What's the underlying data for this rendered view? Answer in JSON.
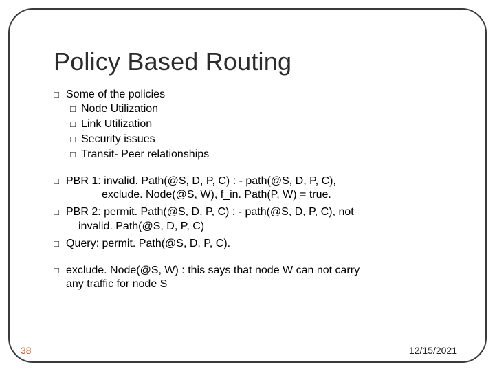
{
  "title": "Policy Based Routing",
  "section1": {
    "heading": "Some of the policies",
    "items": [
      "Node Utilization",
      "Link Utilization",
      "Security issues",
      "Transit- Peer relationships"
    ]
  },
  "section2": {
    "pbr1_line1": "PBR 1: invalid. Path(@S, D, P, C) : - path(@S, D, P, C),",
    "pbr1_line2": "exclude. Node(@S, W), f_in. Path(P, W) = true.",
    "pbr2_line1": "PBR 2: permit. Path(@S, D, P, C) : - path(@S, D, P, C), not",
    "pbr2_line2": "invalid. Path(@S, D, P, C)",
    "query": "Query: permit. Path(@S, D, P, C)."
  },
  "section3": {
    "line1": "exclude. Node(@S, W) : this says that node W can not carry",
    "line2": "any traffic for node S"
  },
  "pageNumber": "38",
  "date": "12/15/2021"
}
